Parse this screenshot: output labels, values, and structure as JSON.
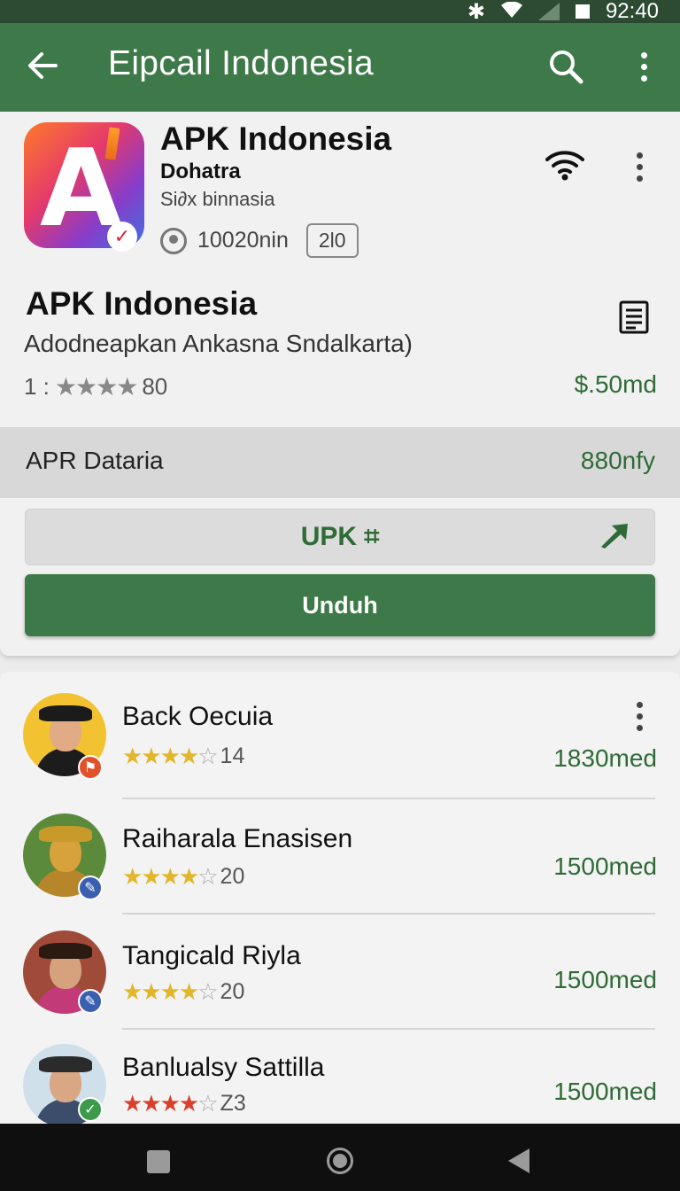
{
  "status_bar": {
    "time": "92:40"
  },
  "appbar": {
    "title": "Eipcail Indonesia"
  },
  "app": {
    "name": "APK Indonesia",
    "developer": "Dohatra",
    "subtitle": "Si∂x binnasia",
    "location_text": "10020nin",
    "badge": "2l0",
    "title": "APK Indonesia",
    "description": "Adodneapkan Ankasna Sndalkarta)",
    "rating_prefix": "1 :",
    "rating_stars": "★★★★",
    "rating_count": "80",
    "price": "$.50md"
  },
  "band": {
    "label": "APR Dataria",
    "value": "880nfy"
  },
  "buttons": {
    "secondary": "UPK ⌗",
    "primary": "Unduh"
  },
  "list": [
    {
      "name": "Back Oecuia",
      "stars": 4,
      "count": "14",
      "price": "1830med"
    },
    {
      "name": "Raiharala Enasisen",
      "stars": 4,
      "count": "20",
      "price": "1500med"
    },
    {
      "name": "Tangicald Riyla",
      "stars": 4,
      "count": "20",
      "price": "1500med"
    },
    {
      "name": "Banlualsy Sattilla",
      "stars": 4,
      "count": "Z3",
      "price": "1500med"
    }
  ],
  "icons": {
    "back": "arrow-left-icon",
    "search": "search-icon",
    "menu": "more-vert-icon",
    "wifi": "wifi-icon",
    "document": "document-icon",
    "share": "share-arrow-icon",
    "nav": [
      "recent-apps-icon",
      "home-icon",
      "back-icon"
    ]
  },
  "colors": {
    "primary": "#3e7a49",
    "price": "#2f6b37",
    "star": "#e2b62b"
  }
}
